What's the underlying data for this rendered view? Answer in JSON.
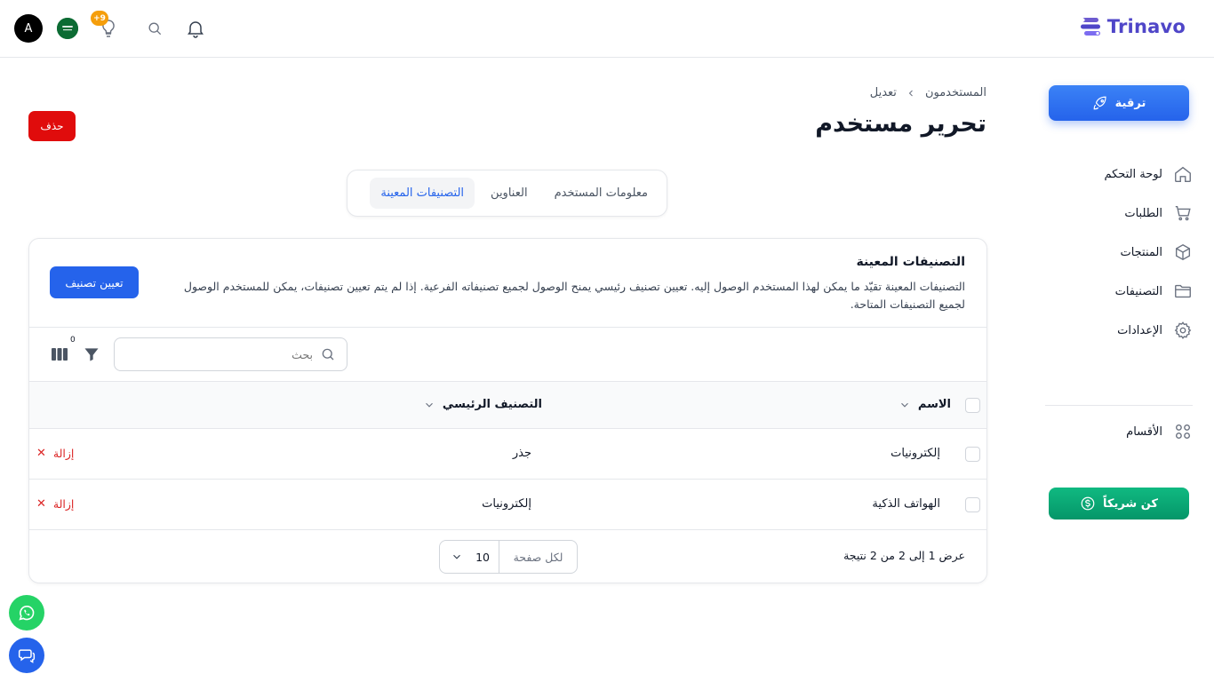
{
  "brand": {
    "name": "Trinavo",
    "color": "#4f46c8"
  },
  "header": {
    "avatar_letter": "A",
    "notification_badge": "+9"
  },
  "sidebar": {
    "upgrade_label": "ترقية",
    "items": [
      {
        "label": "لوحة التحكم",
        "icon": "home-icon"
      },
      {
        "label": "الطلبات",
        "icon": "cart-icon"
      },
      {
        "label": "المنتجات",
        "icon": "box-icon"
      },
      {
        "label": "التصنيفات",
        "icon": "folder-icon"
      },
      {
        "label": "الإعدادات",
        "icon": "gear-icon"
      }
    ],
    "sections_label": "الأقسام",
    "partner_label": "كن شريكاً"
  },
  "main": {
    "breadcrumb": {
      "parent": "المستخدمون",
      "current": "تعديل"
    },
    "title": "تحرير مستخدم",
    "delete_label": "حذف",
    "tabs": [
      {
        "label": "معلومات المستخدم",
        "active": false
      },
      {
        "label": "العناوين",
        "active": false
      },
      {
        "label": "التصنيفات المعينة",
        "active": true
      }
    ],
    "card": {
      "title": "التصنيفات المعينة",
      "description": "التصنيفات المعينة تقيّد ما يمكن لهذا المستخدم الوصول إليه. تعيين تصنيف رئيسي يمنح الوصول لجميع تصنيفاته الفرعية. إذا لم يتم تعيين تصنيفات، يمكن للمستخدم الوصول لجميع التصنيفات المتاحة.",
      "assign_label": "تعيين تصنيف",
      "search_placeholder": "بحث",
      "filter_count": "0",
      "columns": {
        "name": "الاسم",
        "parent": "التصنيف الرئيسي"
      },
      "rows": [
        {
          "name": "إلكترونيات",
          "parent": "جذر",
          "action": "إزالة"
        },
        {
          "name": "الهواتف الذكية",
          "parent": "إلكترونيات",
          "action": "إزالة"
        }
      ],
      "results_text": "عرض 1 إلى 2 من 2 نتيجة",
      "per_page_label": "لكل صفحة",
      "per_page_value": "10"
    }
  },
  "colors": {
    "primary": "#2563eb",
    "danger": "#e00c0c",
    "success": "#10b981"
  }
}
